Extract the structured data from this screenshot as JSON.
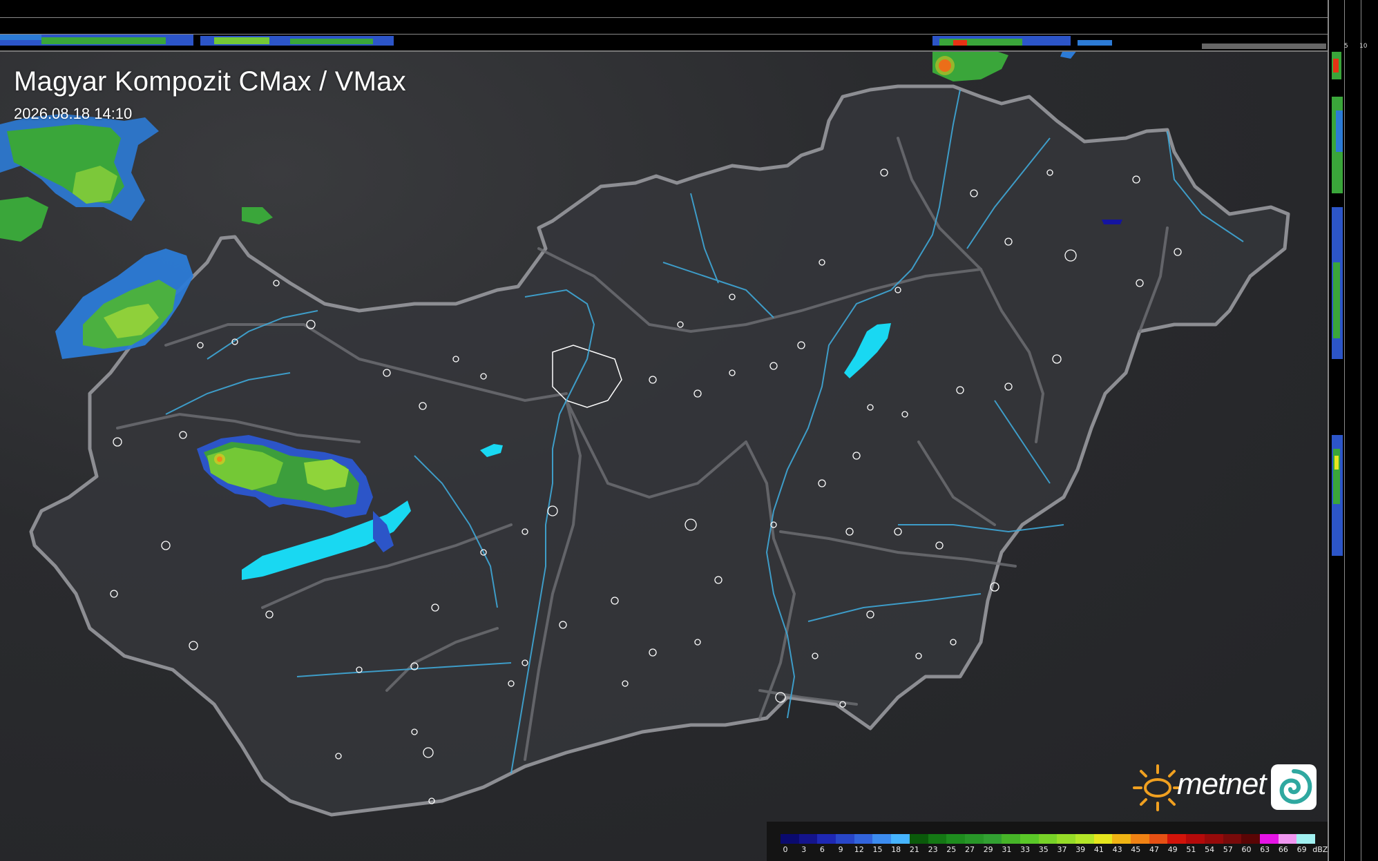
{
  "map": {
    "title": "Magyar Kompozit CMax / VMax",
    "timestamp": "2026.08.18 14:10"
  },
  "cross_section": {
    "top_ticks": [
      "10",
      "5"
    ],
    "right_ticks": [
      "5",
      "10"
    ]
  },
  "branding": {
    "logo_text": "metnet"
  },
  "legend": {
    "unit": "dBZ",
    "values": [
      "0",
      "3",
      "6",
      "9",
      "12",
      "15",
      "18",
      "21",
      "23",
      "25",
      "27",
      "29",
      "31",
      "33",
      "35",
      "37",
      "39",
      "41",
      "43",
      "45",
      "47",
      "49",
      "51",
      "54",
      "57",
      "60",
      "63",
      "66",
      "69"
    ],
    "colors": [
      "#0a0a6e",
      "#14148c",
      "#1e28b4",
      "#2846c8",
      "#3264dc",
      "#3c8cf0",
      "#46b4ff",
      "#0a5a0a",
      "#147814",
      "#1e8c1e",
      "#289628",
      "#32a032",
      "#46b428",
      "#5ac828",
      "#78d228",
      "#96dc28",
      "#b4e628",
      "#e6e61e",
      "#f0b414",
      "#f08214",
      "#e65014",
      "#d2140a",
      "#b40a0a",
      "#960a0a",
      "#780a0a",
      "#5a0505",
      "#e614e6",
      "#f096f0",
      "#a0f0f0"
    ],
    "accent_colors": {
      "lakes": "#19d8f2",
      "rivers": "#3fa8d8",
      "borders": "#8d8e93",
      "cities": "#ffffff"
    }
  }
}
